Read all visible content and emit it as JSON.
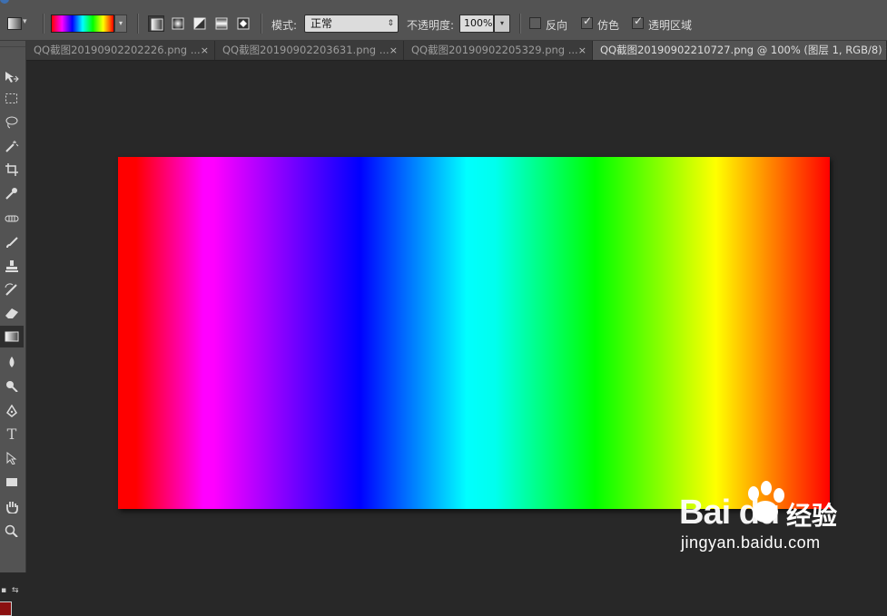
{
  "options_bar": {
    "mode_label": "模式:",
    "mode_value": "正常",
    "opacity_label": "不透明度:",
    "opacity_value": "100%",
    "reverse_label": "反向",
    "dither_label": "仿色",
    "transparency_label": "透明区域",
    "reverse_checked": false,
    "dither_checked": true,
    "transparency_checked": true
  },
  "tabs": [
    {
      "label": "QQ截图20190902202226.png ...",
      "close": "×",
      "active": false
    },
    {
      "label": "QQ截图20190902203631.png ...",
      "close": "×",
      "active": false
    },
    {
      "label": "QQ截图20190902205329.png ...",
      "close": "×",
      "active": false
    },
    {
      "label": "QQ截图20190902210727.png @ 100% (图层 1, RGB/8) *",
      "close": "",
      "active": true
    }
  ],
  "tools": [
    "move-tool",
    "marquee-tool",
    "lasso-tool",
    "magic-wand-tool",
    "crop-tool",
    "eyedropper-tool",
    "healing-brush-tool",
    "brush-tool",
    "clone-stamp-tool",
    "history-brush-tool",
    "eraser-tool",
    "gradient-tool",
    "blur-tool",
    "dodge-tool",
    "pen-tool",
    "type-tool",
    "path-selection-tool",
    "rectangle-tool",
    "hand-tool",
    "zoom-tool"
  ],
  "active_tool": "gradient-tool",
  "text_tool_glyph": "T",
  "foreground_color": "#8b1010",
  "watermark": {
    "logo": "Bai du",
    "cn": "经验",
    "url": "jingyan.baidu.com"
  }
}
